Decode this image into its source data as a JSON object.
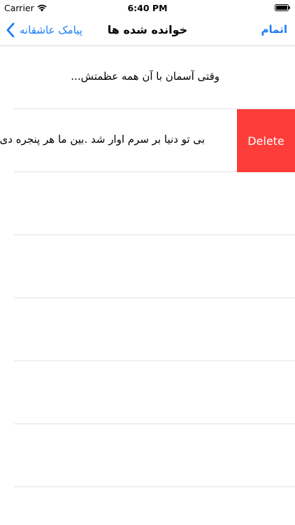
{
  "status_bar": {
    "carrier": "Carrier",
    "time": "6:40 PM"
  },
  "nav": {
    "back_label": "پیامک عاشقانه",
    "title": "خوانده شده ها",
    "right_label": "اتمام"
  },
  "rows": [
    {
      "text": "وقتی آسمان با آن همه عظمتش..."
    },
    {
      "text": "بی تو دنیا بر سرم اوار شد .بین ما هر پنجره دی‌وار شد",
      "delete_label": "Delete"
    },
    {
      "text": ""
    },
    {
      "text": ""
    },
    {
      "text": ""
    },
    {
      "text": ""
    },
    {
      "text": ""
    }
  ],
  "colors": {
    "accent": "#1a7cf5",
    "delete": "#fc3d39",
    "separator": "#e3e3e5"
  }
}
